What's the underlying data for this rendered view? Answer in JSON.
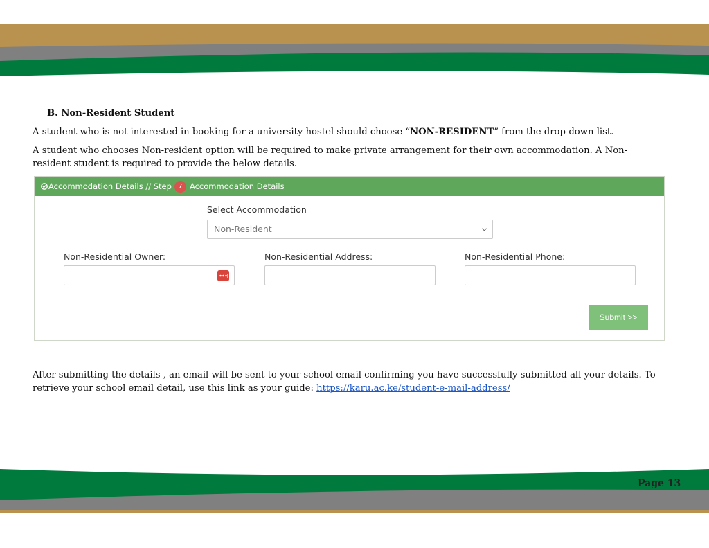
{
  "document": {
    "section_heading": "B.   Non-Resident Student",
    "para1_before": "A student who is not interested in booking for a university hostel should choose “",
    "para1_bold": "NON-RESIDENT",
    "para1_after": "” from the drop-down list.",
    "para2": "A student who chooses Non-resident option will be required to make private arrangement for their own accommodation.  A Non-resident student is required to provide the below details.",
    "para3_text": "After submitting the details , an email will be sent to your school email confirming you have successfully submitted all your details. To retrieve your school email detail, use this link as your guide: ",
    "para3_link": "https://karu.ac.ke/student-e-mail-address/",
    "page_number": "Page 13"
  },
  "form": {
    "header_prefix": "Accommodation Details // Step",
    "step_number": "7",
    "header_suffix": "Accommodation Details",
    "select_label": "Select Accommodation",
    "select_value": "Non-Resident",
    "owner_label": "Non-Residential Owner:",
    "owner_value": "",
    "address_label": "Non-Residential Address:",
    "address_value": "",
    "phone_label": "Non-Residential Phone:",
    "phone_value": "",
    "submit_label": "Submit >>"
  },
  "icons": {
    "header_icon": "check-circle-icon",
    "select_icon": "chevron-down-icon",
    "input_icon": "password-manager-dots-icon"
  },
  "colors": {
    "band_gold": "#b9924f",
    "band_gray": "#808080",
    "band_green": "#007a3d",
    "panel_header": "#5fa85b",
    "submit": "#7fc07a",
    "step_badge": "#d9534f",
    "link": "#1a56c8"
  }
}
